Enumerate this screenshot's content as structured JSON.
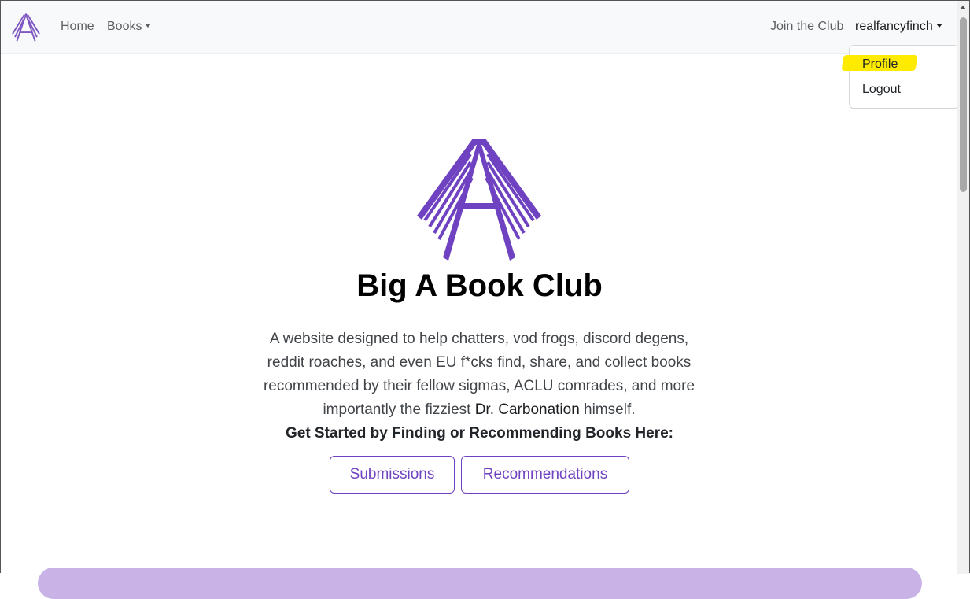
{
  "navbar": {
    "home_label": "Home",
    "books_label": "Books",
    "join_label": "Join the Club",
    "user_label": "realfancyfinch"
  },
  "user_menu": {
    "profile_label": "Profile",
    "logout_label": "Logout"
  },
  "hero": {
    "title": "Big A Book Club",
    "description_part1": "A website designed to help chatters, vod frogs, discord degens, reddit roaches, and even EU f*cks find, share, and collect books recommended by their fellow sigmas, ACLU comrades, and more importantly the fizziest ",
    "description_highlight": "Dr. Carbonation",
    "description_part2": " himself.",
    "cta_heading": "Get Started by Finding or Recommending Books Here:",
    "submissions_label": "Submissions",
    "recommendations_label": "Recommendations"
  },
  "colors": {
    "accent": "#6f42c1",
    "highlight": "#ffeb00"
  },
  "icons": {
    "brand": "big-a-logo-icon",
    "dropdown": "caret-down-icon"
  }
}
